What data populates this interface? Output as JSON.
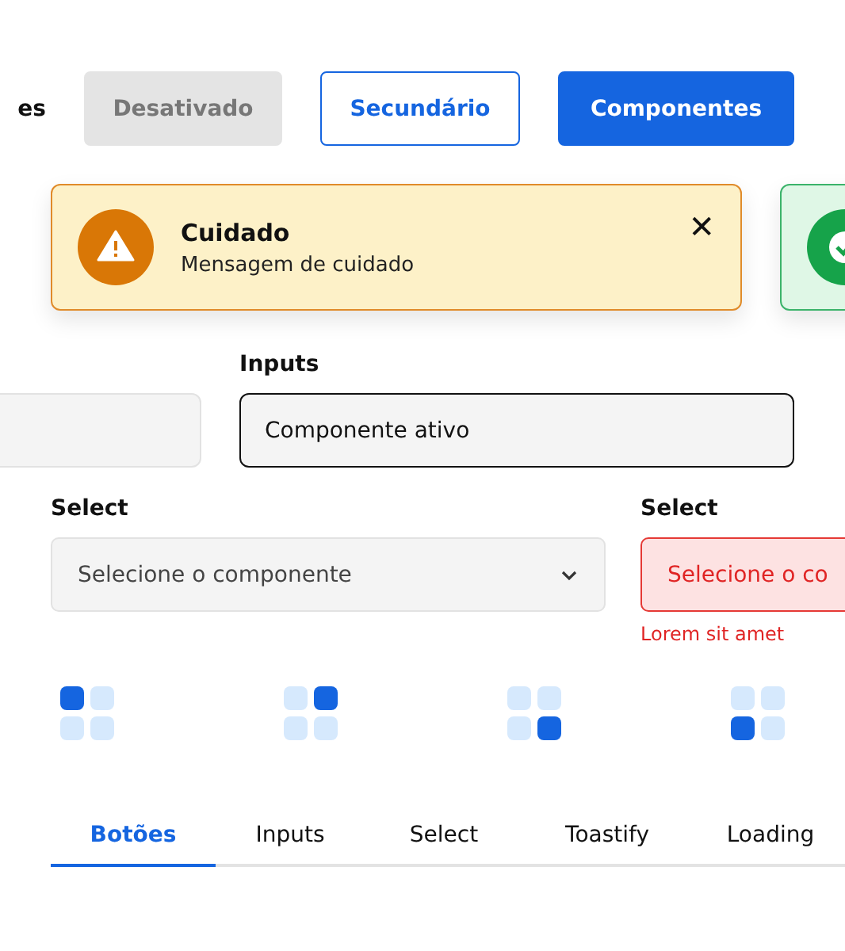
{
  "buttons_row": {
    "label": "es",
    "buttons": [
      {
        "label": "Desativado",
        "kind": "disabled"
      },
      {
        "label": "Secundário",
        "kind": "secondary"
      },
      {
        "label": "Componentes",
        "kind": "primary"
      }
    ]
  },
  "toasts": [
    {
      "kind": "warning",
      "title": "Cuidado",
      "message": "Mensagem de cuidado",
      "close": "✕"
    },
    {
      "kind": "success"
    }
  ],
  "inputs": [
    {
      "focused": false
    },
    {
      "label": "Inputs",
      "value": "Componente ativo",
      "focused": true
    }
  ],
  "selects": [
    {
      "label": "Select",
      "placeholder": "Selecione o componente",
      "error": false
    },
    {
      "label": "Select",
      "placeholder": "Selecione o co",
      "error": true,
      "error_text": "Lorem sit amet"
    }
  ],
  "loaders": [
    {
      "cells": [
        {
          "on": true
        },
        {
          "on": false
        },
        {
          "on": false
        },
        {
          "on": false
        }
      ]
    },
    {
      "cells": [
        {
          "on": false
        },
        {
          "on": true
        },
        {
          "on": false
        },
        {
          "on": false
        }
      ]
    },
    {
      "cells": [
        {
          "on": false
        },
        {
          "on": false
        },
        {
          "on": false
        },
        {
          "on": true
        }
      ]
    },
    {
      "cells": [
        {
          "on": false
        },
        {
          "on": false
        },
        {
          "on": true
        },
        {
          "on": false
        }
      ]
    }
  ],
  "tabs": [
    {
      "label": "Botões",
      "selected": true
    },
    {
      "label": "Inputs",
      "selected": false
    },
    {
      "label": "Select",
      "selected": false
    },
    {
      "label": "Toastify",
      "selected": false
    },
    {
      "label": "Loading",
      "selected": false
    }
  ]
}
